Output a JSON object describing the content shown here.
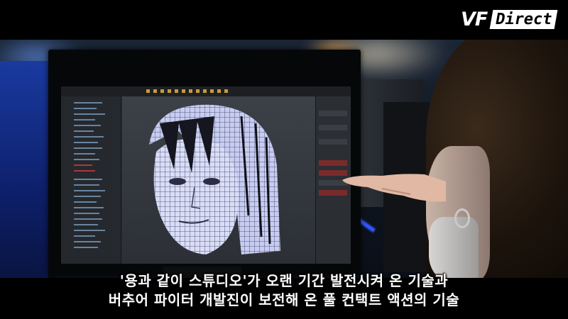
{
  "logo": {
    "brand": "VF",
    "tag": "Direct"
  },
  "subtitles": [
    "'용과 같이 스튜디오'가 오랜 기간 발전시켜 온 기술과",
    "버추어 파이터 개발진이 보전해 온 풀 컨택트 액션의 기술"
  ],
  "colors": {
    "letterbox": "#000000",
    "screen_ui": "#2a2d33",
    "wireframe": "#c8cdf0",
    "subtitle_text": "#ffffff"
  }
}
